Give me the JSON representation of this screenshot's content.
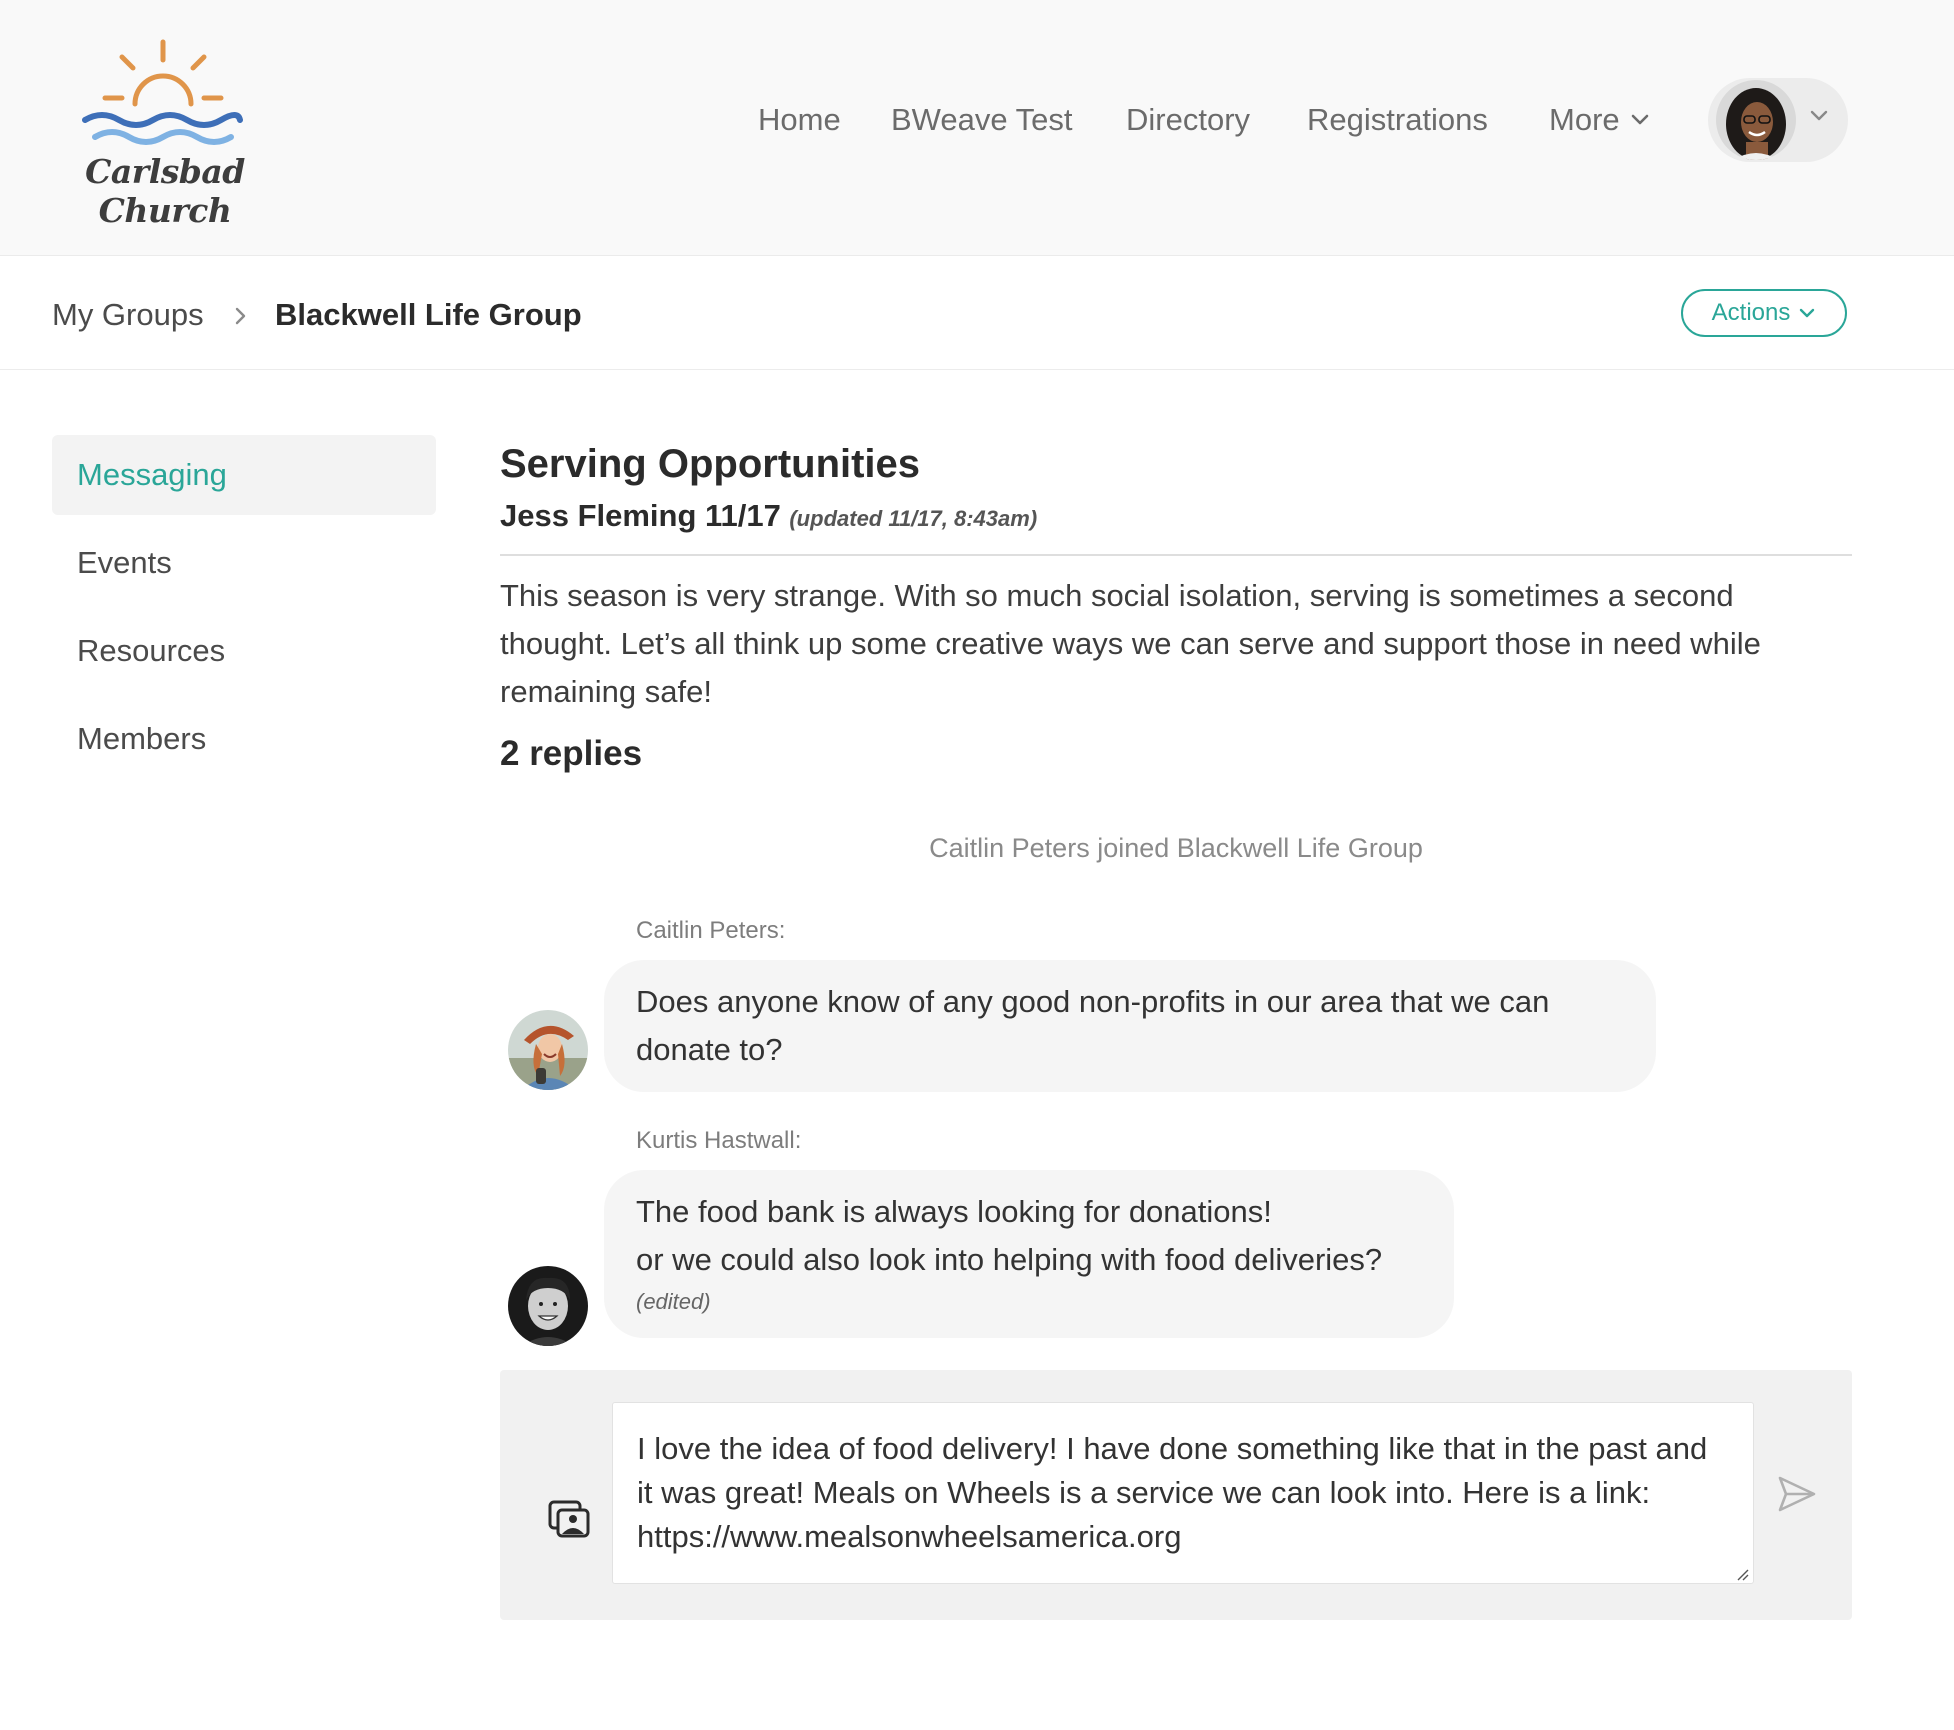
{
  "brand": {
    "name": "Carlsbad Church",
    "sun_color": "#e0954a",
    "wave_dark": "#3e6fb8",
    "wave_light": "#7fb2e3"
  },
  "nav": {
    "items": [
      "Home",
      "BWeave Test",
      "Directory",
      "Registrations"
    ],
    "more_label": "More"
  },
  "breadcrumb": {
    "root": "My Groups",
    "current": "Blackwell Life Group"
  },
  "actions_label": "Actions",
  "accent_color": "#2aa698",
  "sidebar": {
    "items": [
      {
        "label": "Messaging",
        "active": true
      },
      {
        "label": "Events",
        "active": false
      },
      {
        "label": "Resources",
        "active": false
      },
      {
        "label": "Members",
        "active": false
      }
    ]
  },
  "post": {
    "title": "Serving Opportunities",
    "author_date": "Jess Fleming 11/17",
    "updated": "(updated 11/17, 8:43am)",
    "body": "This season is very strange. With so much social isolation, serving is sometimes a second thought. Let’s all think up some creative ways we can serve and support those in need while remaining safe!",
    "replies_count": "2 replies"
  },
  "system_message": "Caitlin Peters joined Blackwell Life Group",
  "messages": [
    {
      "sender": "Caitlin Peters:",
      "text": "Does anyone know of any good non-profits in our area that we can donate to?"
    },
    {
      "sender": "Kurtis Hastwall:",
      "line1": "The food bank is always looking for donations!",
      "line2": "or we could also look into helping with food deliveries?",
      "edited": "(edited)"
    }
  ],
  "composer": {
    "value": "I love the idea of food delivery! I have done something like that in the past and it was great! Meals on Wheels is a service we can look into. Here is a link: https://www.mealsonwheelsamerica.org"
  }
}
